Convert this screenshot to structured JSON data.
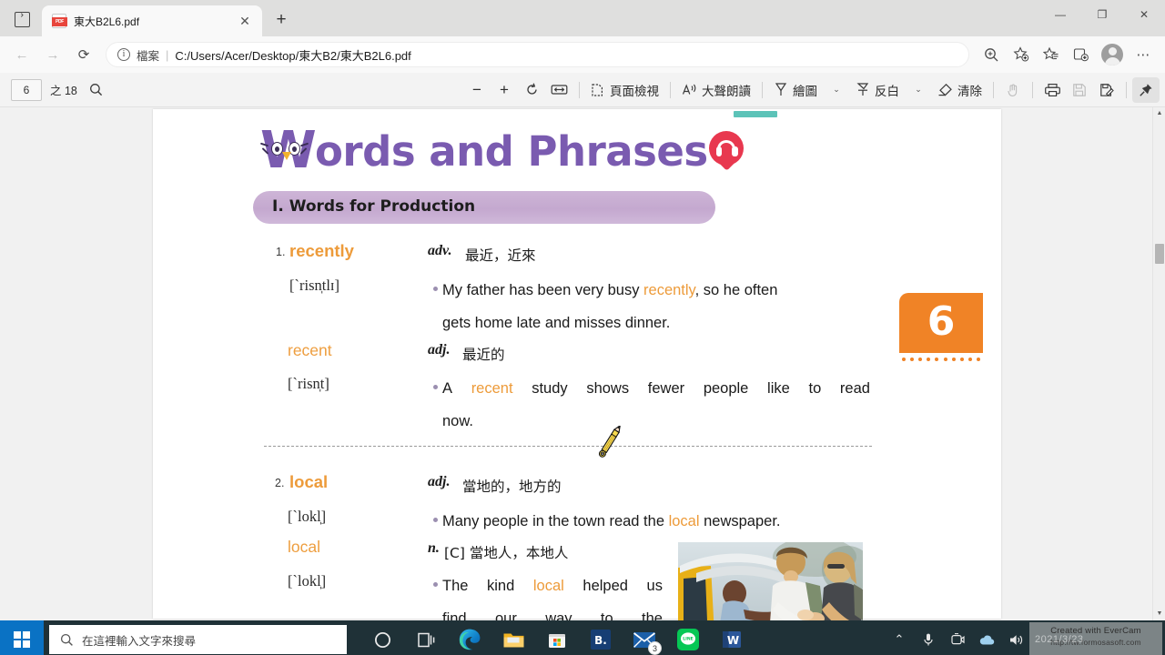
{
  "browser": {
    "tab": {
      "title": "東大B2L6.pdf",
      "favicon": "pdf-file-icon",
      "close": "✕"
    },
    "new_tab_label": "+",
    "window_controls": {
      "minimize": "—",
      "maximize": "❐",
      "close": "✕"
    },
    "nav": {
      "back": "←",
      "forward": "→",
      "reload": "⟳",
      "file_label": "檔案",
      "separator": "|",
      "url": "C:/Users/Acer/Desktop/東大B2/東大B2L6.pdf",
      "zoom_icon": "zoom-in-icon",
      "favorite_add_icon": "add-favorite-icon",
      "favorites_icon": "favorites-list-icon",
      "collections_icon": "collections-icon",
      "profile_icon": "profile-avatar-icon",
      "settings_icon": "more-options-icon"
    }
  },
  "pdf_toolbar": {
    "current_page": "6",
    "page_of": "之 18",
    "search_icon": "search-icon",
    "zoom_out": "−",
    "zoom_in": "+",
    "rotate_icon": "rotate-icon",
    "fit_page_icon": "fit-to-width-icon",
    "page_view_icon": "page-view-icon",
    "page_view_label": "頁面檢視",
    "read_aloud_icon": "read-aloud-icon",
    "read_aloud_label": "大聲朗讀",
    "draw_icon": "draw-pen-icon",
    "draw_label": "繪圖",
    "draw_caret": "⌄",
    "highlight_icon": "highlighter-icon",
    "highlight_label": "反白",
    "highlight_caret": "⌄",
    "erase_icon": "eraser-icon",
    "erase_label": "清除",
    "hand_icon": "hand-tool-icon",
    "print_icon": "print-icon",
    "save_icon": "save-icon",
    "save_as_icon": "save-as-icon",
    "pin_icon": "pin-toolbar-icon"
  },
  "document": {
    "title": "ords and Phrases",
    "title_initial": "W",
    "audio_icon": "audio-headphones-pin-icon",
    "section_heading": "I. Words for Production",
    "page_badge": "6",
    "entries": [
      {
        "number": "1.",
        "headword": "recently",
        "phonetic": "[`risn̩tlɪ]",
        "pos": "adv.",
        "zh": "最近，近來",
        "example_pre": "My father has been very busy ",
        "example_hl": "recently",
        "example_post": ", so he often",
        "example_line2": "gets home late and misses dinner."
      },
      {
        "number": "",
        "headword": "recent",
        "phonetic": "[`risn̩t]",
        "pos": "adj.",
        "zh": "最近的",
        "example_words": [
          "A",
          "recent",
          "study",
          "shows",
          "fewer",
          "people",
          "like",
          "to",
          "read"
        ],
        "example_hl_index": 1,
        "example_line2": "now."
      },
      {
        "number": "2.",
        "headword": "local",
        "phonetic": "[`lokl̩]",
        "pos": "adj.",
        "zh": "當地的，地方的",
        "example_pre": "Many people in the town read the ",
        "example_hl": "local",
        "example_post": " newspaper."
      },
      {
        "number": "",
        "headword": "local",
        "phonetic": "[`lokl̩]",
        "pos": "n.",
        "zh": "[C] 當地人，本地人",
        "example_words": [
          "The",
          "kind",
          "local",
          "helped",
          "us"
        ],
        "example_hl_index": 2,
        "example_line2_words": [
          "find",
          "our",
          "way",
          "to",
          "the"
        ]
      }
    ],
    "photo_alt": "local-pointing-directions-photo",
    "pencil_cursor": "pencil-cursor-icon"
  },
  "taskbar": {
    "start_icon": "windows-start-icon",
    "search_placeholder": "在這裡輸入文字來搜尋",
    "search_icon": "search-icon",
    "task_view_icon": "task-view-icon",
    "cortana_icon": "cortana-circle-icon",
    "apps": [
      {
        "name": "edge-icon"
      },
      {
        "name": "file-explorer-icon"
      },
      {
        "name": "microsoft-store-icon"
      },
      {
        "name": "bitcomet-icon",
        "label": "B."
      },
      {
        "name": "mail-icon",
        "badge": "3"
      },
      {
        "name": "line-icon",
        "label": "LINE"
      },
      {
        "name": "word-icon",
        "label": "W"
      }
    ],
    "tray": {
      "expand_icon": "show-hidden-icons-icon",
      "mic_icon": "microphone-icon",
      "camera_icon": "camera-icon",
      "cloud_icon": "onedrive-icon",
      "volume_icon": "volume-icon"
    },
    "watermark_line1": "Created with EverCam",
    "watermark_line2": "http://tw.formosasoft.com",
    "watermark_stamp": "2021/3/23"
  },
  "colors": {
    "accent_orange": "#ed9b3a",
    "title_purple": "#7a5bb0",
    "pill_purple": "#bfa1cb",
    "badge_orange": "#f08326",
    "taskbar": "#1f3137",
    "teal": "#5cc3b8"
  }
}
